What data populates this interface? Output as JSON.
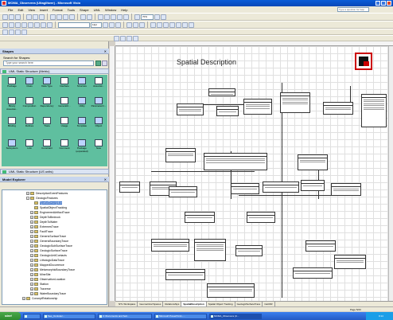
{
  "window": {
    "title": "MOMA_Observera (Uitagiltwer) - Microsoft Visio"
  },
  "menu": {
    "items": [
      "File",
      "Edit",
      "View",
      "Insert",
      "Format",
      "Tools",
      "Shape",
      "UML",
      "Window",
      "Help"
    ],
    "help_placeholder": "Type a question for help"
  },
  "toolbar": {
    "zoom": "70%",
    "font_size": "12pt"
  },
  "shapes_panel": {
    "title": "Shapes",
    "search_label": "Search for Shapes:",
    "search_placeholder": "Type your search here",
    "stencil_title": "UML Static Structure (Metric)",
    "shapes": [
      "Package",
      "Class",
      "Data Type",
      "Interface",
      "Structure",
      "Associat...",
      "Binary Associat...",
      "Composition",
      "Dependency",
      "Generaliz...",
      "Utility",
      "Parameteriz...",
      "Binding",
      "Refines",
      "Trace",
      "Usage",
      "Template",
      "Object",
      "Subsystem",
      "Link",
      "Constraint",
      "Comment",
      "Package (expanded)",
      "Note"
    ],
    "stencil2_title": "UML Static Structure (US units)"
  },
  "model_explorer": {
    "title": "Model Explorer",
    "items": [
      "DescriptionEventFeatures",
      "GeologicFeatures",
      "SpatialDescription",
      "SpatialObjectTracking",
      "EngineeredArtifactTrace",
      "DepthToBedrock",
      "DepthToWater",
      "ExtremesTrace",
      "FaultTrace",
      "GenericSurfaceTrace",
      "GenericBoundaryTrace",
      "GeologicSubSurfaceTrace",
      "GeologicSurfaceTrace",
      "GeologicUnitContacts",
      "LithologicDataTrace",
      "MappedOccurrence",
      "MetamorphicBoundaryTrace",
      "MineSite",
      "ObservationLocation",
      "Station",
      "Traverse",
      "WaterBoundaryTrace",
      "ConceptRelationship"
    ]
  },
  "diagram": {
    "title": "Spatial Description"
  },
  "page_tabs": [
    "NTL Workspace",
    "Geometrical Spaces",
    "Relationships",
    "SpatialDescription",
    "Spatial Object Tracking",
    "GeologicSurfaceTrace",
    "CartOR"
  ],
  "status": {
    "page": "Page 5/23"
  },
  "taskbar": {
    "start": "start",
    "tasks": [
      "",
      "See_Uoniotec...",
      "C:\\Documents and Sett...",
      "Microsoft PowerPoint -...",
      "MOMA_Observera (U..."
    ],
    "clock": "9:14"
  }
}
